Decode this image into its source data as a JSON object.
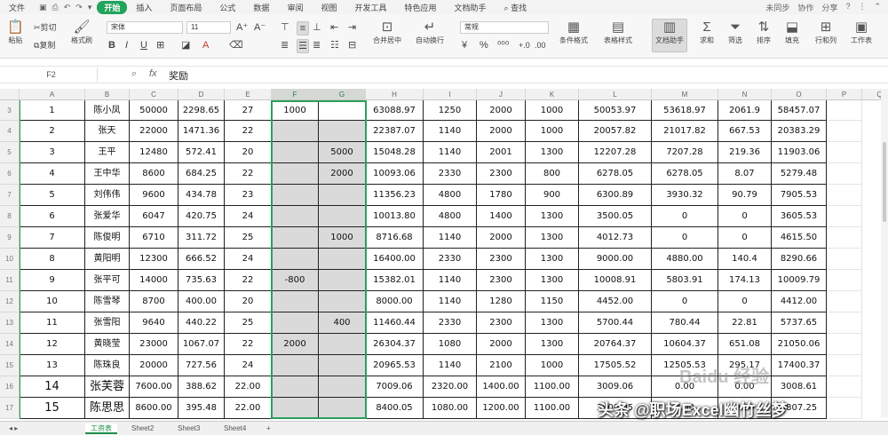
{
  "menu": {
    "file": "文件",
    "tabs": [
      "开始",
      "插入",
      "页面布局",
      "公式",
      "数据",
      "审阅",
      "视图",
      "开发工具",
      "特色应用",
      "文档助手"
    ],
    "search": "查找",
    "right": [
      "未同步",
      "协作",
      "分享"
    ]
  },
  "ribbon": {
    "paste": "粘贴",
    "cut": "剪切",
    "copy": "复制",
    "format_painter": "格式刷",
    "font_name": "宋体",
    "font_size": "11",
    "merge_center": "合并居中",
    "wrap_text": "自动换行",
    "number_format": "常规",
    "conditional_format": "条件格式",
    "table_style": "表格样式",
    "doc_assistant": "文档助手",
    "sum": "求和",
    "filter": "筛选",
    "sort": "排序",
    "fill": "填充",
    "row_col": "行和列",
    "worksheet": "工作表"
  },
  "formula_bar": {
    "name_box": "F2",
    "fx_label": "fx",
    "content": "奖励"
  },
  "columns": [
    "A",
    "B",
    "C",
    "D",
    "E",
    "F",
    "G",
    "H",
    "I",
    "J",
    "K",
    "L",
    "M",
    "N",
    "O",
    "P",
    "Q"
  ],
  "row_numbers": [
    "3",
    "4",
    "5",
    "6",
    "7",
    "8",
    "9",
    "10",
    "11",
    "12",
    "13",
    "14",
    "15",
    "16",
    "17"
  ],
  "rows": [
    [
      "1",
      "陈小凤",
      "50000",
      "2298.65",
      "27",
      "1000",
      "",
      "63088.97",
      "1250",
      "2000",
      "1000",
      "50053.97",
      "53618.97",
      "2061.9",
      "58457.07"
    ],
    [
      "2",
      "张天",
      "22000",
      "1471.36",
      "22",
      "",
      "",
      "22387.07",
      "1140",
      "2000",
      "1000",
      "20057.82",
      "21017.82",
      "667.53",
      "20383.29"
    ],
    [
      "3",
      "王平",
      "12480",
      "572.41",
      "20",
      "",
      "5000",
      "15048.28",
      "1140",
      "2001",
      "1300",
      "12207.28",
      "7207.28",
      "219.36",
      "11903.06"
    ],
    [
      "4",
      "王中华",
      "8600",
      "684.25",
      "22",
      "",
      "2000",
      "10093.06",
      "2330",
      "2300",
      "800",
      "6278.05",
      "6278.05",
      "8.07",
      "5279.48"
    ],
    [
      "5",
      "刘伟伟",
      "9600",
      "434.78",
      "23",
      "",
      "",
      "11356.23",
      "4800",
      "1780",
      "900",
      "6300.89",
      "3930.32",
      "90.79",
      "7905.53"
    ],
    [
      "6",
      "张爱华",
      "6047",
      "420.75",
      "24",
      "",
      "",
      "10013.80",
      "4800",
      "1400",
      "1300",
      "3500.05",
      "0",
      "0",
      "3605.53"
    ],
    [
      "7",
      "陈俊明",
      "6710",
      "311.72",
      "25",
      "",
      "1000",
      "8716.68",
      "1140",
      "2000",
      "1300",
      "4012.73",
      "0",
      "0",
      "4615.50"
    ],
    [
      "8",
      "黄阳明",
      "12300",
      "666.52",
      "24",
      "",
      "",
      "16400.00",
      "2330",
      "2300",
      "1300",
      "9000.00",
      "4880.00",
      "140.4",
      "8290.66"
    ],
    [
      "9",
      "张平可",
      "14000",
      "735.63",
      "22",
      "-800",
      "",
      "15382.01",
      "1140",
      "2300",
      "1300",
      "10008.91",
      "5803.91",
      "174.13",
      "10009.79"
    ],
    [
      "10",
      "陈雪琴",
      "8700",
      "400.00",
      "20",
      "",
      "",
      "8000.00",
      "1140",
      "1280",
      "1150",
      "4452.00",
      "0",
      "0",
      "4412.00"
    ],
    [
      "11",
      "张雪阳",
      "9640",
      "440.22",
      "25",
      "",
      "400",
      "11460.44",
      "2330",
      "2300",
      "1300",
      "5700.44",
      "780.44",
      "22.81",
      "5737.65"
    ],
    [
      "12",
      "黄晓莹",
      "23000",
      "1067.07",
      "22",
      "2000",
      "",
      "26304.37",
      "1080",
      "2000",
      "1300",
      "20764.37",
      "10604.37",
      "651.08",
      "21050.06"
    ],
    [
      "13",
      "陈珠良",
      "20000",
      "727.56",
      "24",
      "",
      "",
      "20965.53",
      "1140",
      "2100",
      "1000",
      "17505.52",
      "12505.53",
      "295.17",
      "17400.37"
    ],
    [
      "14",
      "张芙蓉",
      "7600.00",
      "388.62",
      "22.00",
      "",
      "",
      "7009.06",
      "2320.00",
      "1400.00",
      "1100.00",
      "3009.06",
      "0.00",
      "0.00",
      "3008.61"
    ],
    [
      "15",
      "陈思思",
      "8600.00",
      "395.48",
      "22.00",
      "",
      "",
      "8400.05",
      "1080.00",
      "1200.00",
      "1100.00",
      "3900.05",
      "0.00",
      "0.00",
      "3807.25"
    ]
  ],
  "sheets": [
    "工资表",
    "Sheet2",
    "Sheet3",
    "Sheet4"
  ],
  "watermark_site": "Baidu 经验",
  "watermark_author": "头条 @职场Excel幽竹丝梦",
  "colors": {
    "accent": "#22a45a",
    "selection": "#2aa05a",
    "grey_cell": "#dadada"
  }
}
